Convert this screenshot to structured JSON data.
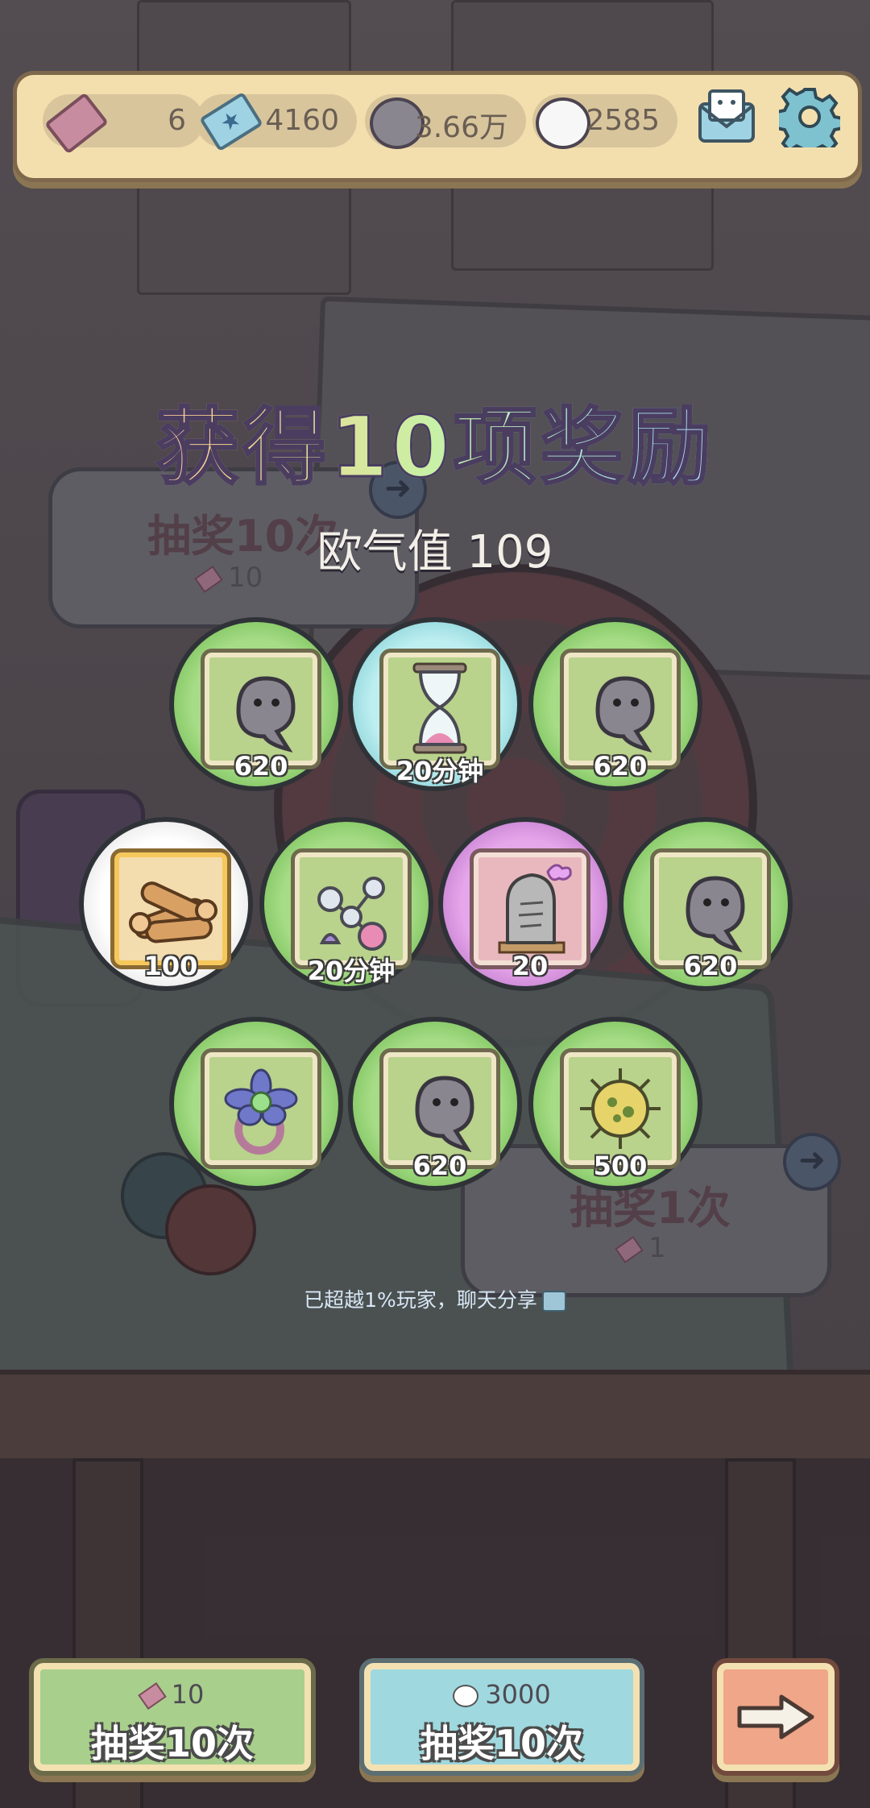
{
  "currencies": [
    {
      "name": "ticket",
      "value": "6"
    },
    {
      "name": "star-ticket",
      "value": "4160"
    },
    {
      "name": "black-ghost",
      "value": "3.66万"
    },
    {
      "name": "white-ghost",
      "value": "2585"
    }
  ],
  "background": {
    "draw10_title": "抽奖10次",
    "draw10_cost": "10",
    "draw1_title": "抽奖1次",
    "draw1_cost": "1"
  },
  "result": {
    "title": "获得10项奖励",
    "luck_label": "欧气值 109",
    "share_text": "已超越1%玩家，聊天分享"
  },
  "rewards": [
    {
      "icon": "black-ghost-icon",
      "qty": "620",
      "rarity": "green"
    },
    {
      "icon": "hourglass-icon",
      "qty": "20分钟",
      "rarity": "blue"
    },
    {
      "icon": "black-ghost-icon",
      "qty": "620",
      "rarity": "green"
    },
    {
      "icon": "firewood-icon",
      "qty": "100",
      "rarity": "white"
    },
    {
      "icon": "molecule-icon",
      "qty": "20分钟",
      "rarity": "green"
    },
    {
      "icon": "tombstone-icon",
      "qty": "20",
      "rarity": "purple"
    },
    {
      "icon": "black-ghost-icon",
      "qty": "620",
      "rarity": "green"
    },
    {
      "icon": "flower-ring-icon",
      "qty": "",
      "rarity": "green"
    },
    {
      "icon": "black-ghost-icon",
      "qty": "620",
      "rarity": "green"
    },
    {
      "icon": "virus-orb-icon",
      "qty": "500",
      "rarity": "green"
    }
  ],
  "buttons": {
    "ticket_draw": {
      "cost": "10",
      "label": "抽奖10次"
    },
    "ghost_draw": {
      "cost": "3000",
      "label": "抽奖10次"
    },
    "next": {
      "icon": "arrow-right-icon"
    }
  },
  "colors": {
    "green_rarity": "#7dc35e",
    "blue_rarity": "#8cd4da",
    "white_rarity": "#e6e6e6",
    "purple_rarity": "#c47fd0"
  }
}
